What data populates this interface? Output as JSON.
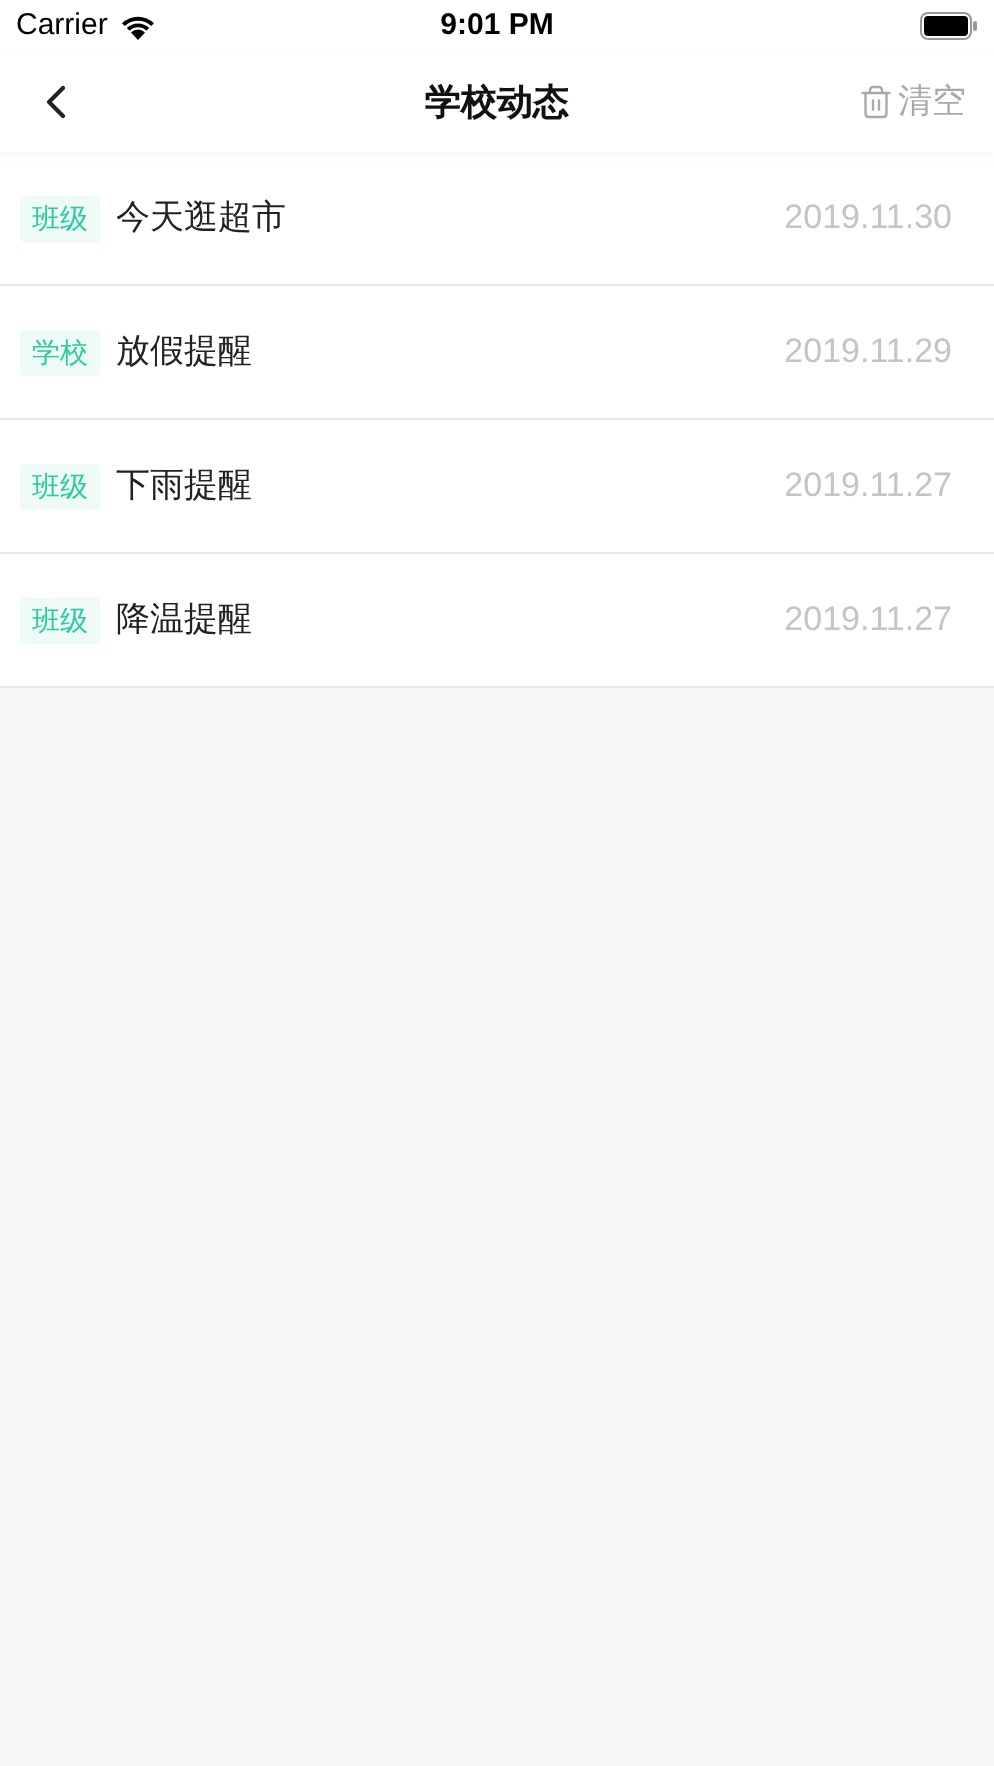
{
  "status_bar": {
    "carrier": "Carrier",
    "time": "9:01 PM"
  },
  "nav": {
    "title": "学校动态",
    "clear_label": "清空"
  },
  "items": [
    {
      "tag": "班级",
      "title": "今天逛超市",
      "date": "2019.11.30"
    },
    {
      "tag": "学校",
      "title": "放假提醒",
      "date": "2019.11.29"
    },
    {
      "tag": "班级",
      "title": "下雨提醒",
      "date": "2019.11.27"
    },
    {
      "tag": "班级",
      "title": "降温提醒",
      "date": "2019.11.27"
    }
  ]
}
